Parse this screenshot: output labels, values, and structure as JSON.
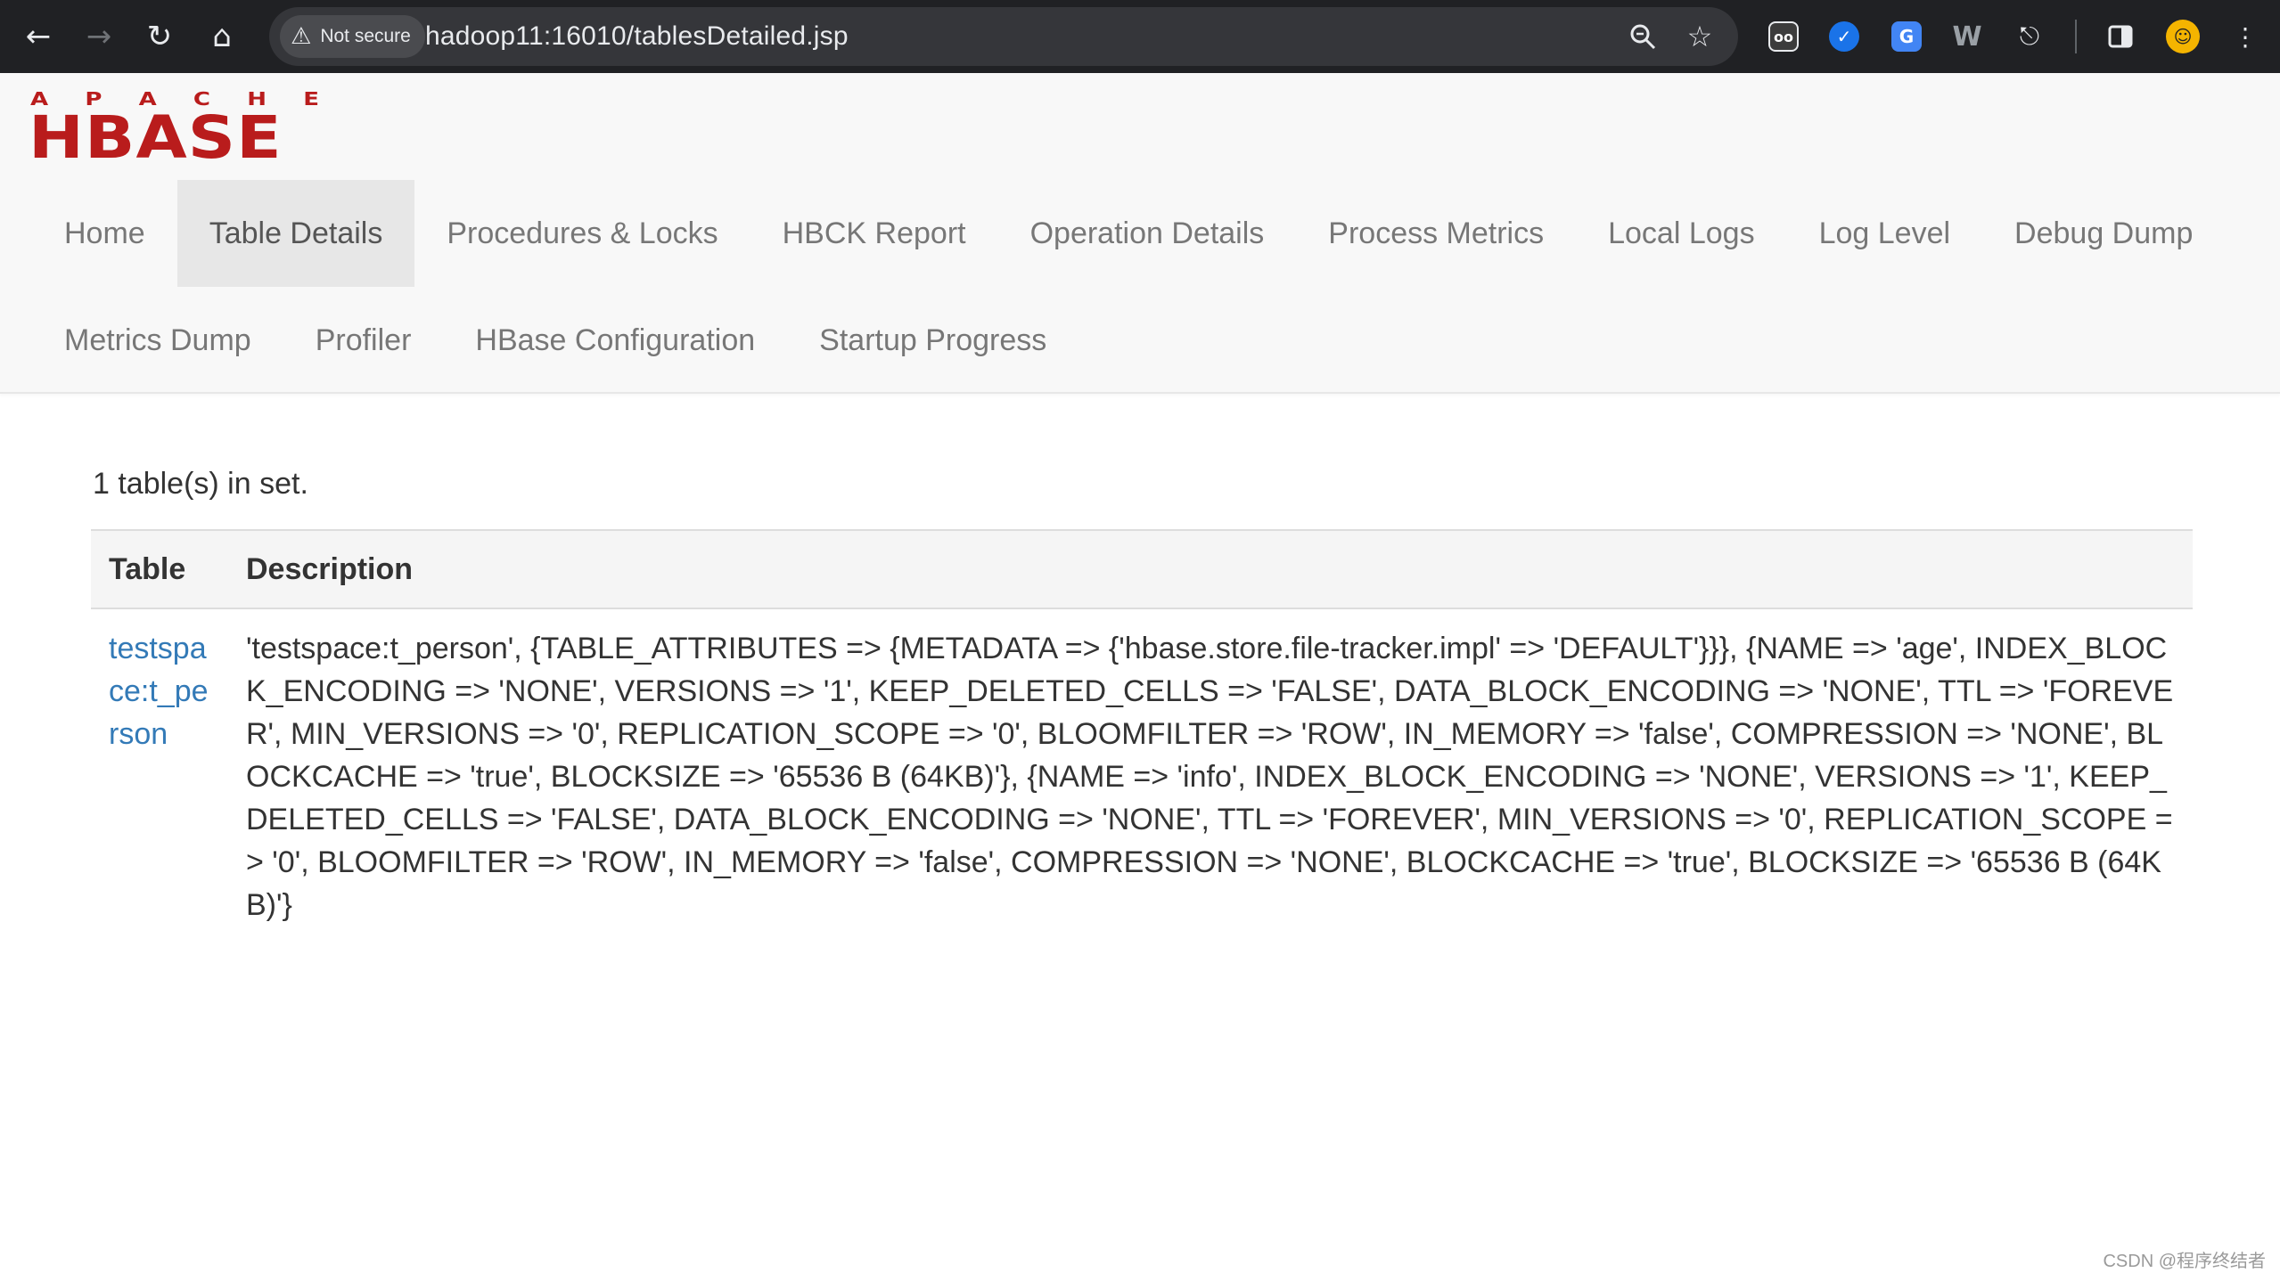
{
  "browser": {
    "security_label": "Not secure",
    "url": "hadoop11:16010/tablesDetailed.jsp",
    "icons": [
      "back-icon",
      "forward-icon",
      "reload-icon",
      "home-icon",
      "warning-icon",
      "zoom-icon",
      "star-icon",
      "extension-icon",
      "side-panel-icon",
      "profile-avatar",
      "menu-icon"
    ]
  },
  "logo": {
    "top_text": "APACHE",
    "main_text": "HBASE",
    "color": "#b91c1c"
  },
  "nav": {
    "row1": [
      "Home",
      "Table Details",
      "Procedures & Locks",
      "HBCK Report",
      "Operation Details",
      "Process Metrics",
      "Local Logs",
      "Log Level",
      "Debug Dump"
    ],
    "row2": [
      "Metrics Dump",
      "Profiler",
      "HBase Configuration",
      "Startup Progress"
    ],
    "active": "Table Details"
  },
  "content": {
    "count_text": "1 table(s) in set.",
    "headers": {
      "table": "Table",
      "description": "Description"
    },
    "rows": [
      {
        "name": "testspace:t_person",
        "description": "'testspace:t_person', {TABLE_ATTRIBUTES => {METADATA => {'hbase.store.file-tracker.impl' => 'DEFAULT'}}}, {NAME => 'age', INDEX_BLOCK_ENCODING => 'NONE', VERSIONS => '1', KEEP_DELETED_CELLS => 'FALSE', DATA_BLOCK_ENCODING => 'NONE', TTL => 'FOREVER', MIN_VERSIONS => '0', REPLICATION_SCOPE => '0', BLOOMFILTER => 'ROW', IN_MEMORY => 'false', COMPRESSION => 'NONE', BLOCKCACHE => 'true', BLOCKSIZE => '65536 B (64KB)'}, {NAME => 'info', INDEX_BLOCK_ENCODING => 'NONE', VERSIONS => '1', KEEP_DELETED_CELLS => 'FALSE', DATA_BLOCK_ENCODING => 'NONE', TTL => 'FOREVER', MIN_VERSIONS => '0', REPLICATION_SCOPE => '0', BLOOMFILTER => 'ROW', IN_MEMORY => 'false', COMPRESSION => 'NONE', BLOCKCACHE => 'true', BLOCKSIZE => '65536 B (64KB)'}"
      }
    ]
  },
  "watermark": "CSDN @程序终结者",
  "colors": {
    "link": "#337ab7",
    "navbar_bg": "#f8f8f8",
    "active_tab_bg": "#e7e7e7",
    "chrome_bg": "#202124"
  }
}
